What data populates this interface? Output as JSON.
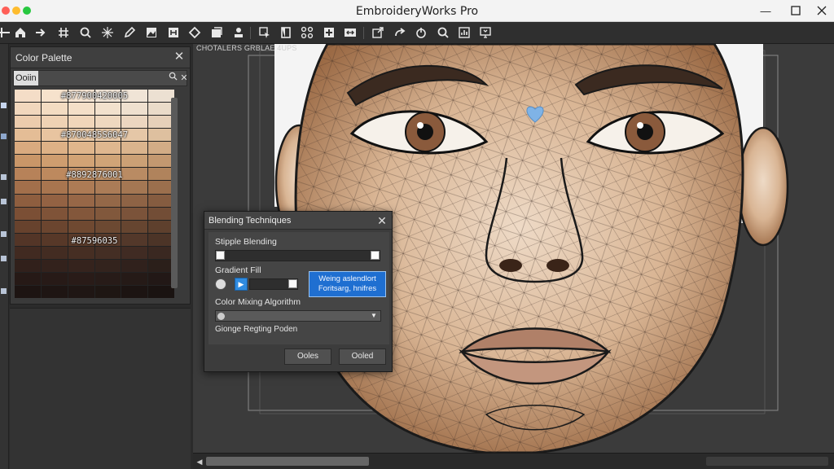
{
  "window": {
    "title": "EmbroideryWorks Pro",
    "minimize_icon": "minimize-icon",
    "maximize_icon": "maximize-icon",
    "close_icon": "close-icon"
  },
  "toolbar": {
    "icons": [
      "grid-icon",
      "home-icon",
      "arrow-right-icon",
      "hash-icon",
      "search-icon",
      "sparkle-icon",
      "pen-icon",
      "image-icon",
      "frame-icon",
      "diamond-icon",
      "layers-icon",
      "stamp-icon",
      "select-icon",
      "page-icon",
      "nodes-icon",
      "add-icon",
      "resize-icon",
      "export-icon",
      "redo-icon",
      "power-icon",
      "zoom-icon",
      "chart-icon",
      "monitor-icon"
    ]
  },
  "palette_panel": {
    "title": "Color Palette",
    "filter_tab": "Ooiin",
    "search_icon": "search-icon",
    "clear_icon": "close-icon",
    "labels": [
      "#877900420005",
      "#8700485S6047",
      "#8892876001",
      "#87596035"
    ],
    "swatch_rows": [
      [
        "#f4ddc7",
        "#f6e2cc",
        "#f7e6d4",
        "#f2e6d8",
        "#f0e4d6",
        "#ece0d2"
      ],
      [
        "#f1d7bd",
        "#f3dcc2",
        "#f4dfc8",
        "#f2e1cd",
        "#efe0cf",
        "#eadbc9"
      ],
      [
        "#ecccad",
        "#efd2b4",
        "#f1d6ba",
        "#efd8bf",
        "#ecd6c0",
        "#e6d0b9"
      ],
      [
        "#e4bd96",
        "#e8c4a0",
        "#eac9a6",
        "#e9caa9",
        "#e5c7a7",
        "#dec09f"
      ],
      [
        "#d9aa7f",
        "#ddb186",
        "#e0b68c",
        "#dfb78f",
        "#dab48d",
        "#d2ac86"
      ],
      [
        "#c99668",
        "#ce9d6f",
        "#d2a375",
        "#d0a477",
        "#cba075",
        "#c39870"
      ],
      [
        "#b78259",
        "#bd895e",
        "#c18f64",
        "#bf9066",
        "#b98b63",
        "#b0835c"
      ],
      [
        "#a26f4b",
        "#a8754f",
        "#ad7b55",
        "#ab7c57",
        "#a47753",
        "#9b6f4d"
      ],
      [
        "#8e5e3f",
        "#936243",
        "#976747",
        "#946848",
        "#8e6345",
        "#855c40"
      ],
      [
        "#7b4f35",
        "#7f5338",
        "#83573b",
        "#81583c",
        "#7b533a",
        "#724d36"
      ],
      [
        "#67422d",
        "#6b452f",
        "#6f4931",
        "#6c4932",
        "#664530",
        "#5e402d"
      ],
      [
        "#533527",
        "#573828",
        "#5a3b2a",
        "#583b2b",
        "#53382a",
        "#4c3427"
      ],
      [
        "#412a21",
        "#432c22",
        "#462e23",
        "#442e24",
        "#402b23",
        "#3a2821"
      ],
      [
        "#31201b",
        "#33221c",
        "#35231d",
        "#33231d",
        "#30211c",
        "#2b1f1a"
      ],
      [
        "#261916",
        "#271a17",
        "#291b18",
        "#271b18",
        "#251a17",
        "#221816"
      ],
      [
        "#1d1412",
        "#1e1513",
        "#1f1614",
        "#1e1613",
        "#1c1412",
        "#1a1311"
      ]
    ]
  },
  "canvas": {
    "caption": "CHOTALERS GRBLAE 4UPS"
  },
  "blending_dialog": {
    "title": "Blending Techniques",
    "stipple_label": "Stipple Blending",
    "stipple_value": 1.0,
    "gradient_label": "Gradient Fill",
    "gradient_value": 1.0,
    "gradient_play_icon": "play-icon",
    "gradient_mode_icon": "radio-icon",
    "highlight_line1": "Weing aslendlort",
    "highlight_line2": "Foritsarg, hnifres",
    "mixing_label": "Color Mixing Algorithm",
    "mixing_select_icon": "chevron-down-icon",
    "footer_label": "Gionge Regting Poden",
    "btn_left": "Ooles",
    "btn_right": "Ooled"
  }
}
